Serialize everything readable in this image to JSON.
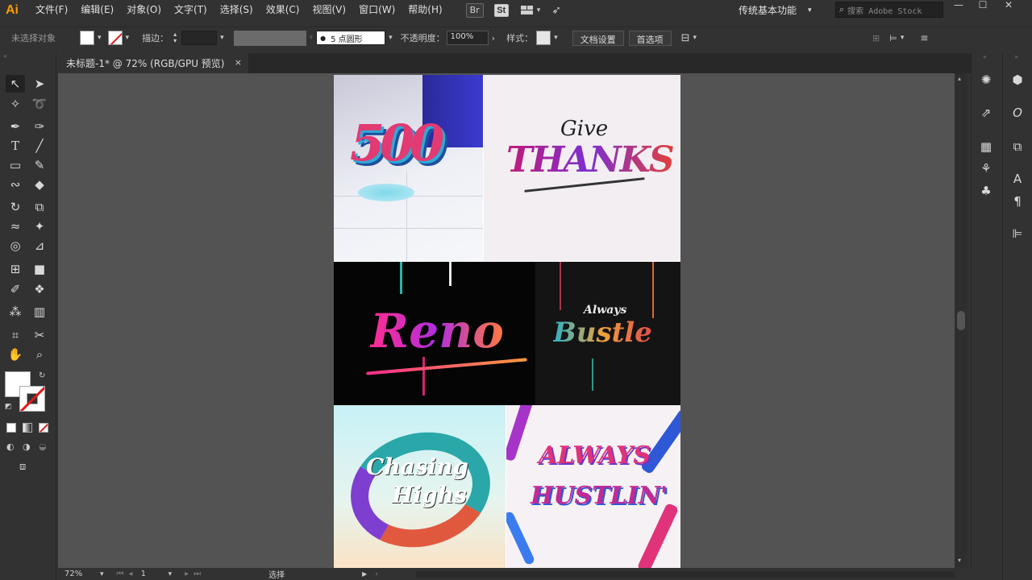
{
  "app": {
    "logo": "Ai"
  },
  "menu": [
    "文件(F)",
    "编辑(E)",
    "对象(O)",
    "文字(T)",
    "选择(S)",
    "效果(C)",
    "视图(V)",
    "窗口(W)",
    "帮助(H)"
  ],
  "menubar_icons": {
    "bridge": "Br",
    "stock": "St"
  },
  "workspace": {
    "label": "传统基本功能"
  },
  "search": {
    "placeholder": "搜索 Adobe Stock"
  },
  "window_controls": {
    "minimize": "—",
    "restore": "☐",
    "close": "✕"
  },
  "control_bar": {
    "no_selection": "未选择对象",
    "stroke_label": "描边：",
    "brush_value": "5 点圆形",
    "opacity_label": "不透明度：",
    "opacity_value": "100%",
    "style_label": "样式：",
    "doc_setup": "文档设置",
    "preferences": "首选项"
  },
  "document_tab": {
    "title": "未标题-1* @ 72% (RGB/GPU 预览)",
    "close": "×"
  },
  "artboard_tiles": {
    "t1": "500",
    "t2_small": "Give",
    "t2_big": "THANKS",
    "t3": "Reno",
    "t4_small": "Always",
    "t4_big": "Bustle",
    "t5_a": "Chasing",
    "t5_b": "Highs",
    "t6_a": "ALWAYS",
    "t6_b": "HUSTLIN'"
  },
  "status_bar": {
    "zoom": "72%",
    "artboard_num": "1",
    "tool_status": "选择"
  },
  "colors": {
    "accent_logo": "#ff9a00",
    "none_red": "#e0191b",
    "panel_bg": "#323232",
    "canvas_bg": "#535353"
  }
}
